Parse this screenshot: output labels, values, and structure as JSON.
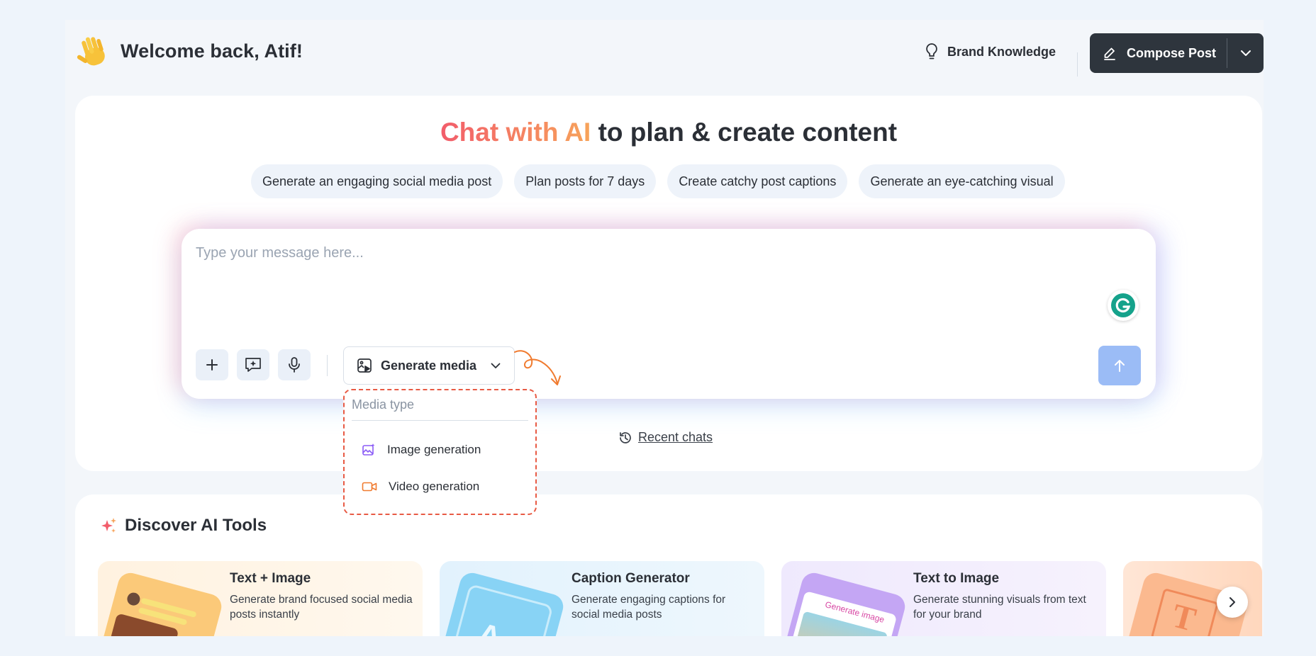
{
  "header": {
    "greeting": "Welcome back, Atif!",
    "brand_knowledge_label": "Brand Knowledge",
    "compose_label": "Compose Post"
  },
  "chat": {
    "headline_highlight": "Chat with AI",
    "headline_rest": " to plan & create content",
    "suggestions": [
      "Generate an engaging social media post",
      "Plan posts for 7 days",
      "Create catchy post captions",
      "Generate an eye-catching visual"
    ],
    "input_placeholder": "Type your message here...",
    "generate_media_label": "Generate media",
    "recent_chats_label": "Recent chats"
  },
  "media_dropdown": {
    "title": "Media type",
    "items": [
      "Image generation",
      "Video generation"
    ]
  },
  "discover": {
    "title": "Discover AI Tools",
    "tools": [
      {
        "title": "Text + Image",
        "desc": "Generate brand focused social media posts instantly"
      },
      {
        "title": "Caption Generator",
        "desc": "Generate engaging captions for social media posts"
      },
      {
        "title": "Text to Image",
        "desc": "Generate stunning visuals from text for your brand"
      }
    ],
    "art_text": "Generate image"
  },
  "colors": {
    "accent_dark": "#2e353d",
    "send_button": "#9bbcf6",
    "headline_gradient_start": "#f25d6b",
    "headline_gradient_end": "#f7a35a",
    "dropdown_border": "#e85a44"
  }
}
